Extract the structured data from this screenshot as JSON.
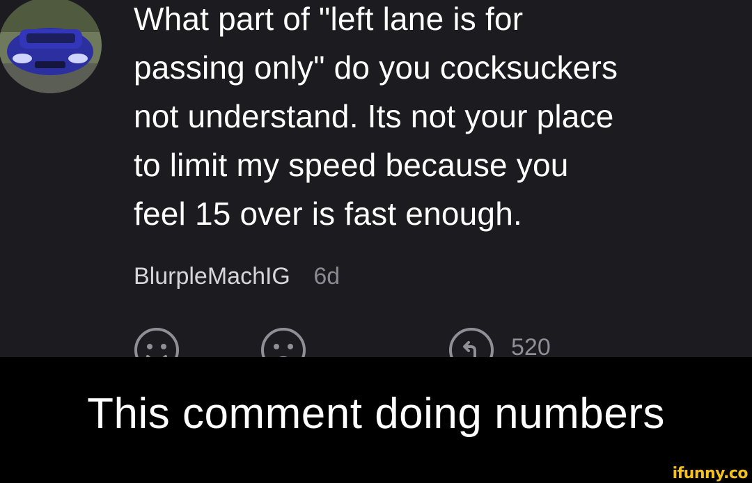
{
  "comment": {
    "text": "What part of \"left lane is for\npassing only\" do you cocksuckers\nnot understand. Its not your place\nto limit my speed because you\nfeel 15 over is fast enough.",
    "username": "BlurpleMachIG",
    "age": "6d",
    "reply_count": "520"
  },
  "caption": "This comment doing numbers",
  "watermark": "ifunny.co",
  "colors": {
    "panel_bg": "#1c1c20",
    "caption_bg": "#000000",
    "text": "#ffffff",
    "meta_text": "#8a8a90",
    "watermark": "#f4c21b"
  },
  "icons": [
    "avatar",
    "smile-icon",
    "frown-icon",
    "reply-icon"
  ]
}
